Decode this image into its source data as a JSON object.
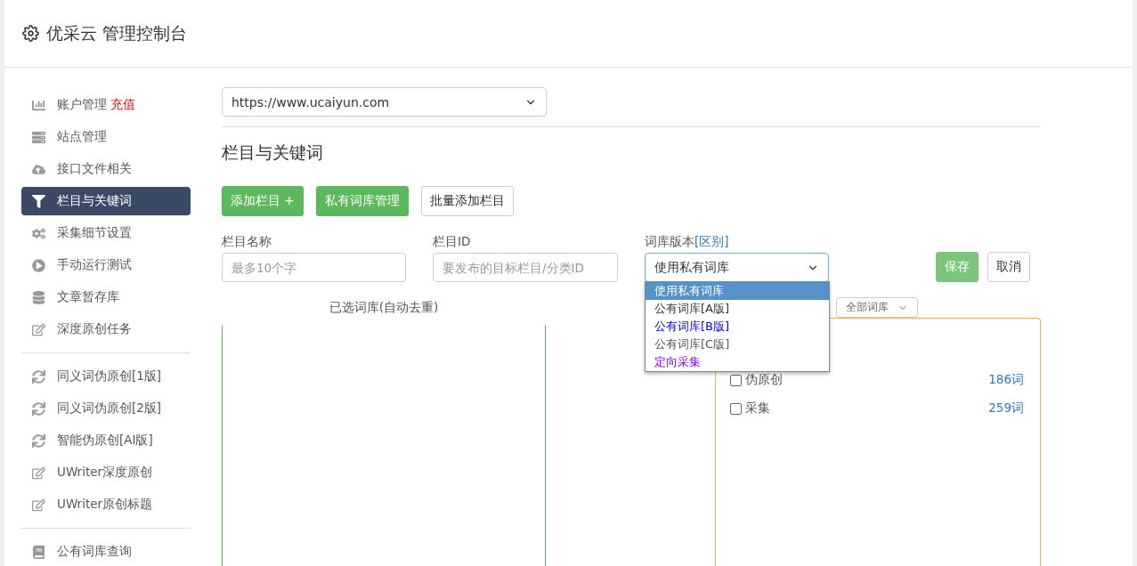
{
  "header": {
    "title": "优采云 管理控制台"
  },
  "sidebar": {
    "groups": [
      {
        "items": [
          {
            "kind": "chart",
            "label": "账户管理",
            "badge": "充值",
            "selected": false
          },
          {
            "kind": "server",
            "label": "站点管理",
            "selected": false
          },
          {
            "kind": "cloud",
            "label": "接口文件相关",
            "selected": false
          },
          {
            "kind": "filter",
            "label": "栏目与关键词",
            "selected": true
          },
          {
            "kind": "gears",
            "label": "采集细节设置",
            "selected": false
          },
          {
            "kind": "play",
            "label": "手动运行测试",
            "selected": false
          },
          {
            "kind": "database",
            "label": "文章暂存库",
            "selected": false
          },
          {
            "kind": "edit",
            "label": "深度原创任务",
            "selected": false
          }
        ]
      },
      {
        "items": [
          {
            "kind": "sync",
            "label": "同义词伪原创[1版]",
            "selected": false
          },
          {
            "kind": "sync",
            "label": "同义词伪原创[2版]",
            "selected": false
          },
          {
            "kind": "sync",
            "label": "智能伪原创[AI版]",
            "selected": false
          },
          {
            "kind": "edit",
            "label": "UWriter深度原创",
            "selected": false
          },
          {
            "kind": "edit",
            "label": "UWriter原创标题",
            "selected": false
          }
        ]
      },
      {
        "items": [
          {
            "kind": "book",
            "label": "公有词库查询",
            "selected": false
          }
        ]
      }
    ]
  },
  "site_select": {
    "value": "https://www.ucaiyun.com"
  },
  "section_title": "栏目与关键词",
  "buttons": [
    {
      "kind": "primary",
      "label": "添加栏目 +"
    },
    {
      "kind": "primary",
      "label": "私有词库管理"
    },
    {
      "kind": "default",
      "label": "批量添加栏目"
    }
  ],
  "form": {
    "name_label": "栏目名称",
    "name_placeholder": "最多10个字",
    "id_label": "栏目ID",
    "id_placeholder": "要发布的目标栏目/分类ID",
    "version_label": "词库版本",
    "version_link": "[区别]",
    "version_value": "使用私有词库",
    "version_options": [
      {
        "label": "使用私有词库",
        "selected": true
      },
      {
        "label": "公有词库[A版]",
        "selected": false,
        "color": "#333333"
      },
      {
        "label": "公有词库[B版]",
        "selected": false,
        "color": "#0000ee"
      },
      {
        "label": "公有词库[C版]",
        "selected": false,
        "color": "#555555"
      },
      {
        "label": "定向采集",
        "selected": false,
        "color": "#8800ee"
      }
    ],
    "save": "保存",
    "cancel": "取消"
  },
  "selected_label": "已选词库(自动去重)",
  "library_filter": {
    "value": "全部词库"
  },
  "libraries": [
    {
      "label": "伪原创",
      "count": "186词",
      "checked": false
    },
    {
      "label": "采集",
      "count": "259词",
      "checked": false
    }
  ]
}
